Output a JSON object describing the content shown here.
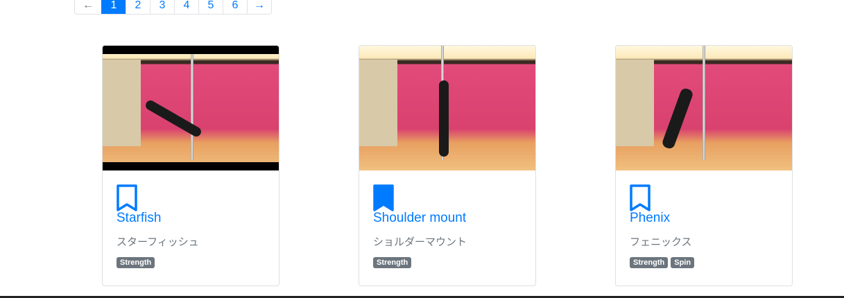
{
  "pagination": {
    "prev": "←",
    "pages": [
      "1",
      "2",
      "3",
      "4",
      "5",
      "6"
    ],
    "next": "→",
    "active": "1"
  },
  "cards": [
    {
      "title": "Starfish",
      "subtitle": "スターフィッシュ",
      "bookmarked": false,
      "tags": [
        "Strength"
      ]
    },
    {
      "title": "Shoulder mount",
      "subtitle": "ショルダーマウント",
      "bookmarked": true,
      "tags": [
        "Strength"
      ]
    },
    {
      "title": "Phenix",
      "subtitle": "フェニックス",
      "bookmarked": false,
      "tags": [
        "Strength",
        "Spin"
      ]
    }
  ],
  "colors": {
    "primary": "#007bff",
    "badge": "#6c757d"
  }
}
